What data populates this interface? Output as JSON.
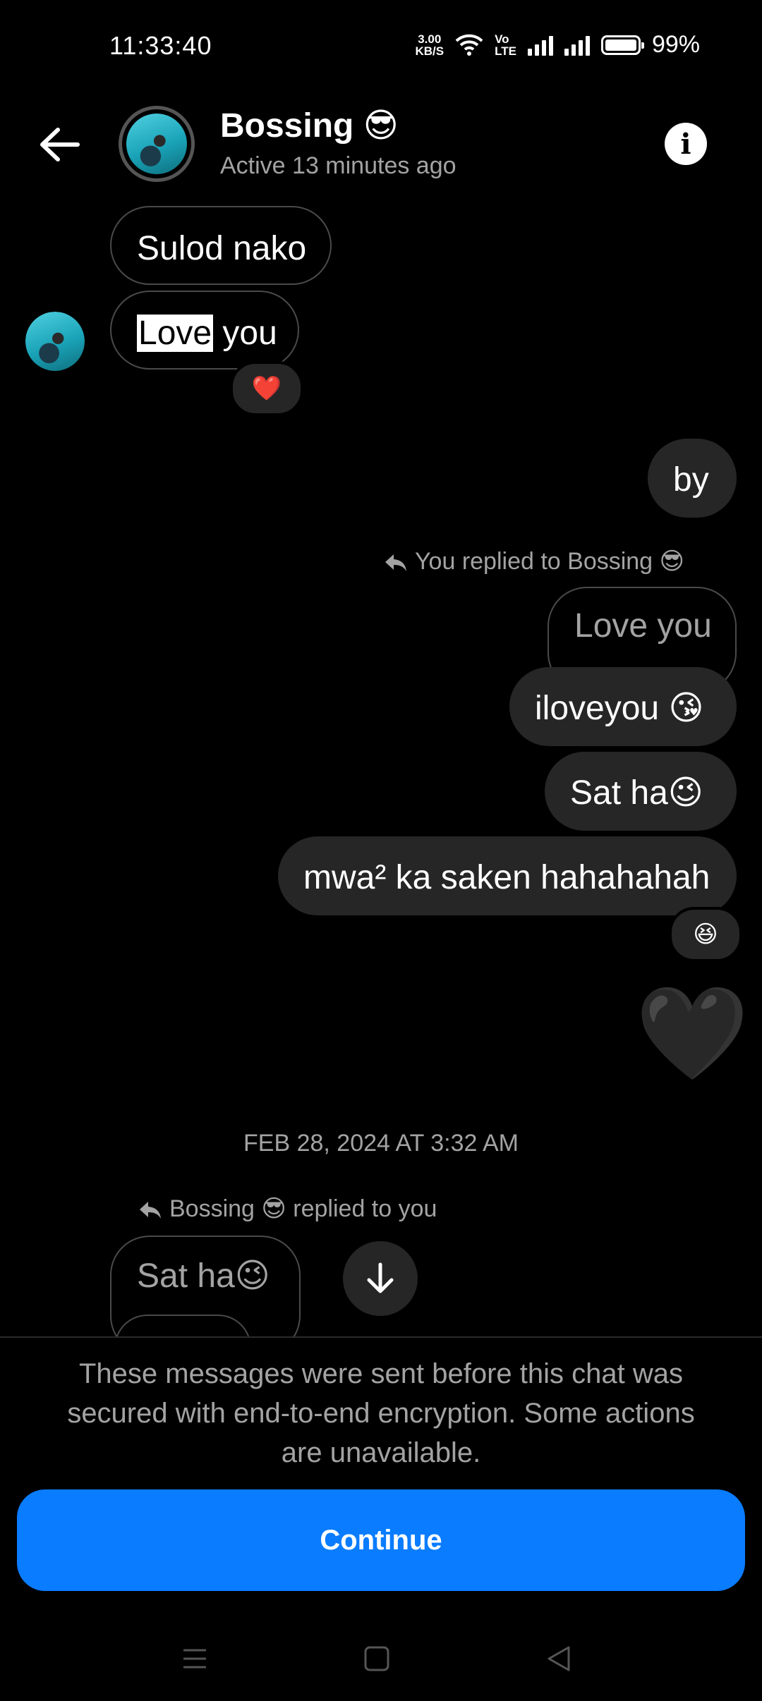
{
  "status_bar": {
    "time": "11:33:40",
    "net_speed_value": "3.00",
    "net_speed_unit": "KB/S",
    "volte_top": "Vo",
    "volte_bottom": "LTE",
    "battery": "99%",
    "battery_level": 0.99
  },
  "header": {
    "name": "Bossing 😎",
    "status": "Active 13 minutes ago"
  },
  "messages": {
    "m1": "Sulod nako",
    "m2_highlight": "Love",
    "m2_rest": " you",
    "m2_reaction": "❤️",
    "m3": "by",
    "reply_note_1": "You replied to Bossing 😎",
    "quoted_1": "Love you",
    "m4": "iloveyou 😘",
    "m5": "Sat ha😉",
    "m6": "mwa² ka saken hahahahah",
    "m6_reaction": "😆",
    "m7": "🖤",
    "timestamp": "FEB 28, 2024 AT 3:32 AM",
    "reply_note_2": "Bossing 😎 replied to you",
    "quoted_2": "Sat ha😉"
  },
  "notice": {
    "text": "These messages were sent before this chat was secured with end-to-end encryption. Some actions are unavailable.",
    "button": "Continue",
    "accent": "#0a7cff"
  },
  "icons": {
    "back": "arrow-left-icon",
    "info": "info-icon",
    "reply": "reply-arrow-icon",
    "scroll": "arrow-down-icon",
    "nav_menu": "menu-icon",
    "nav_home": "home-square-icon",
    "nav_back": "back-triangle-icon"
  }
}
